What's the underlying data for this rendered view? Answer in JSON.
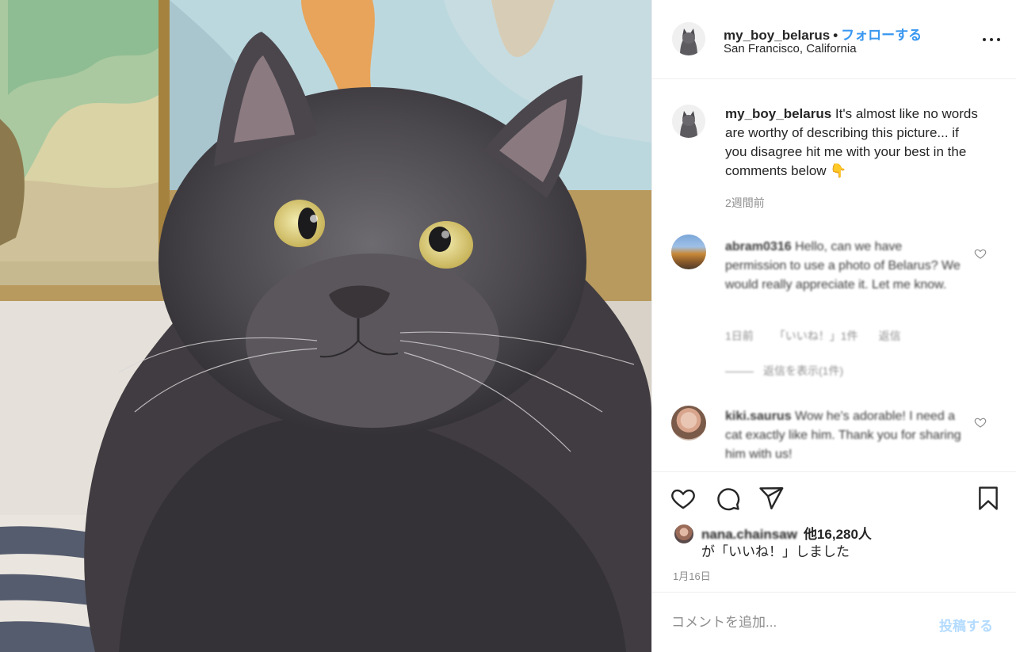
{
  "post": {
    "image_alt": "gray long-haired cat looking up",
    "header": {
      "username": "my_boy_belarus",
      "separator": "•",
      "follow_label": "フォローする",
      "location": "San Francisco, California"
    },
    "caption": {
      "username": "my_boy_belarus",
      "text": "It's almost like no words are worthy of describing this picture... if you disagree hit me with your best in the comments below 👇",
      "time": "2週間前"
    },
    "comments": [
      {
        "username": "abram0316",
        "text": "Hello, can we have permission to use a photo of Belarus? We would really appreciate it. Let me know.",
        "time": "1日前",
        "likes": "「いいね！」1件",
        "reply_label": "返信",
        "view_replies": "返信を表示(1件)"
      },
      {
        "username": "kiki.saurus",
        "text": "Wow he's adorable! I need a cat exactly like him. Thank you for sharing him with us!",
        "time": ""
      }
    ],
    "likes": {
      "liker": "nana.chainsaw",
      "others": "他16,280人",
      "suffix": "が「いいね！」しました"
    },
    "date": "1月16日",
    "add_comment": {
      "placeholder": "コメントを追加...",
      "post_label": "投稿する"
    }
  }
}
